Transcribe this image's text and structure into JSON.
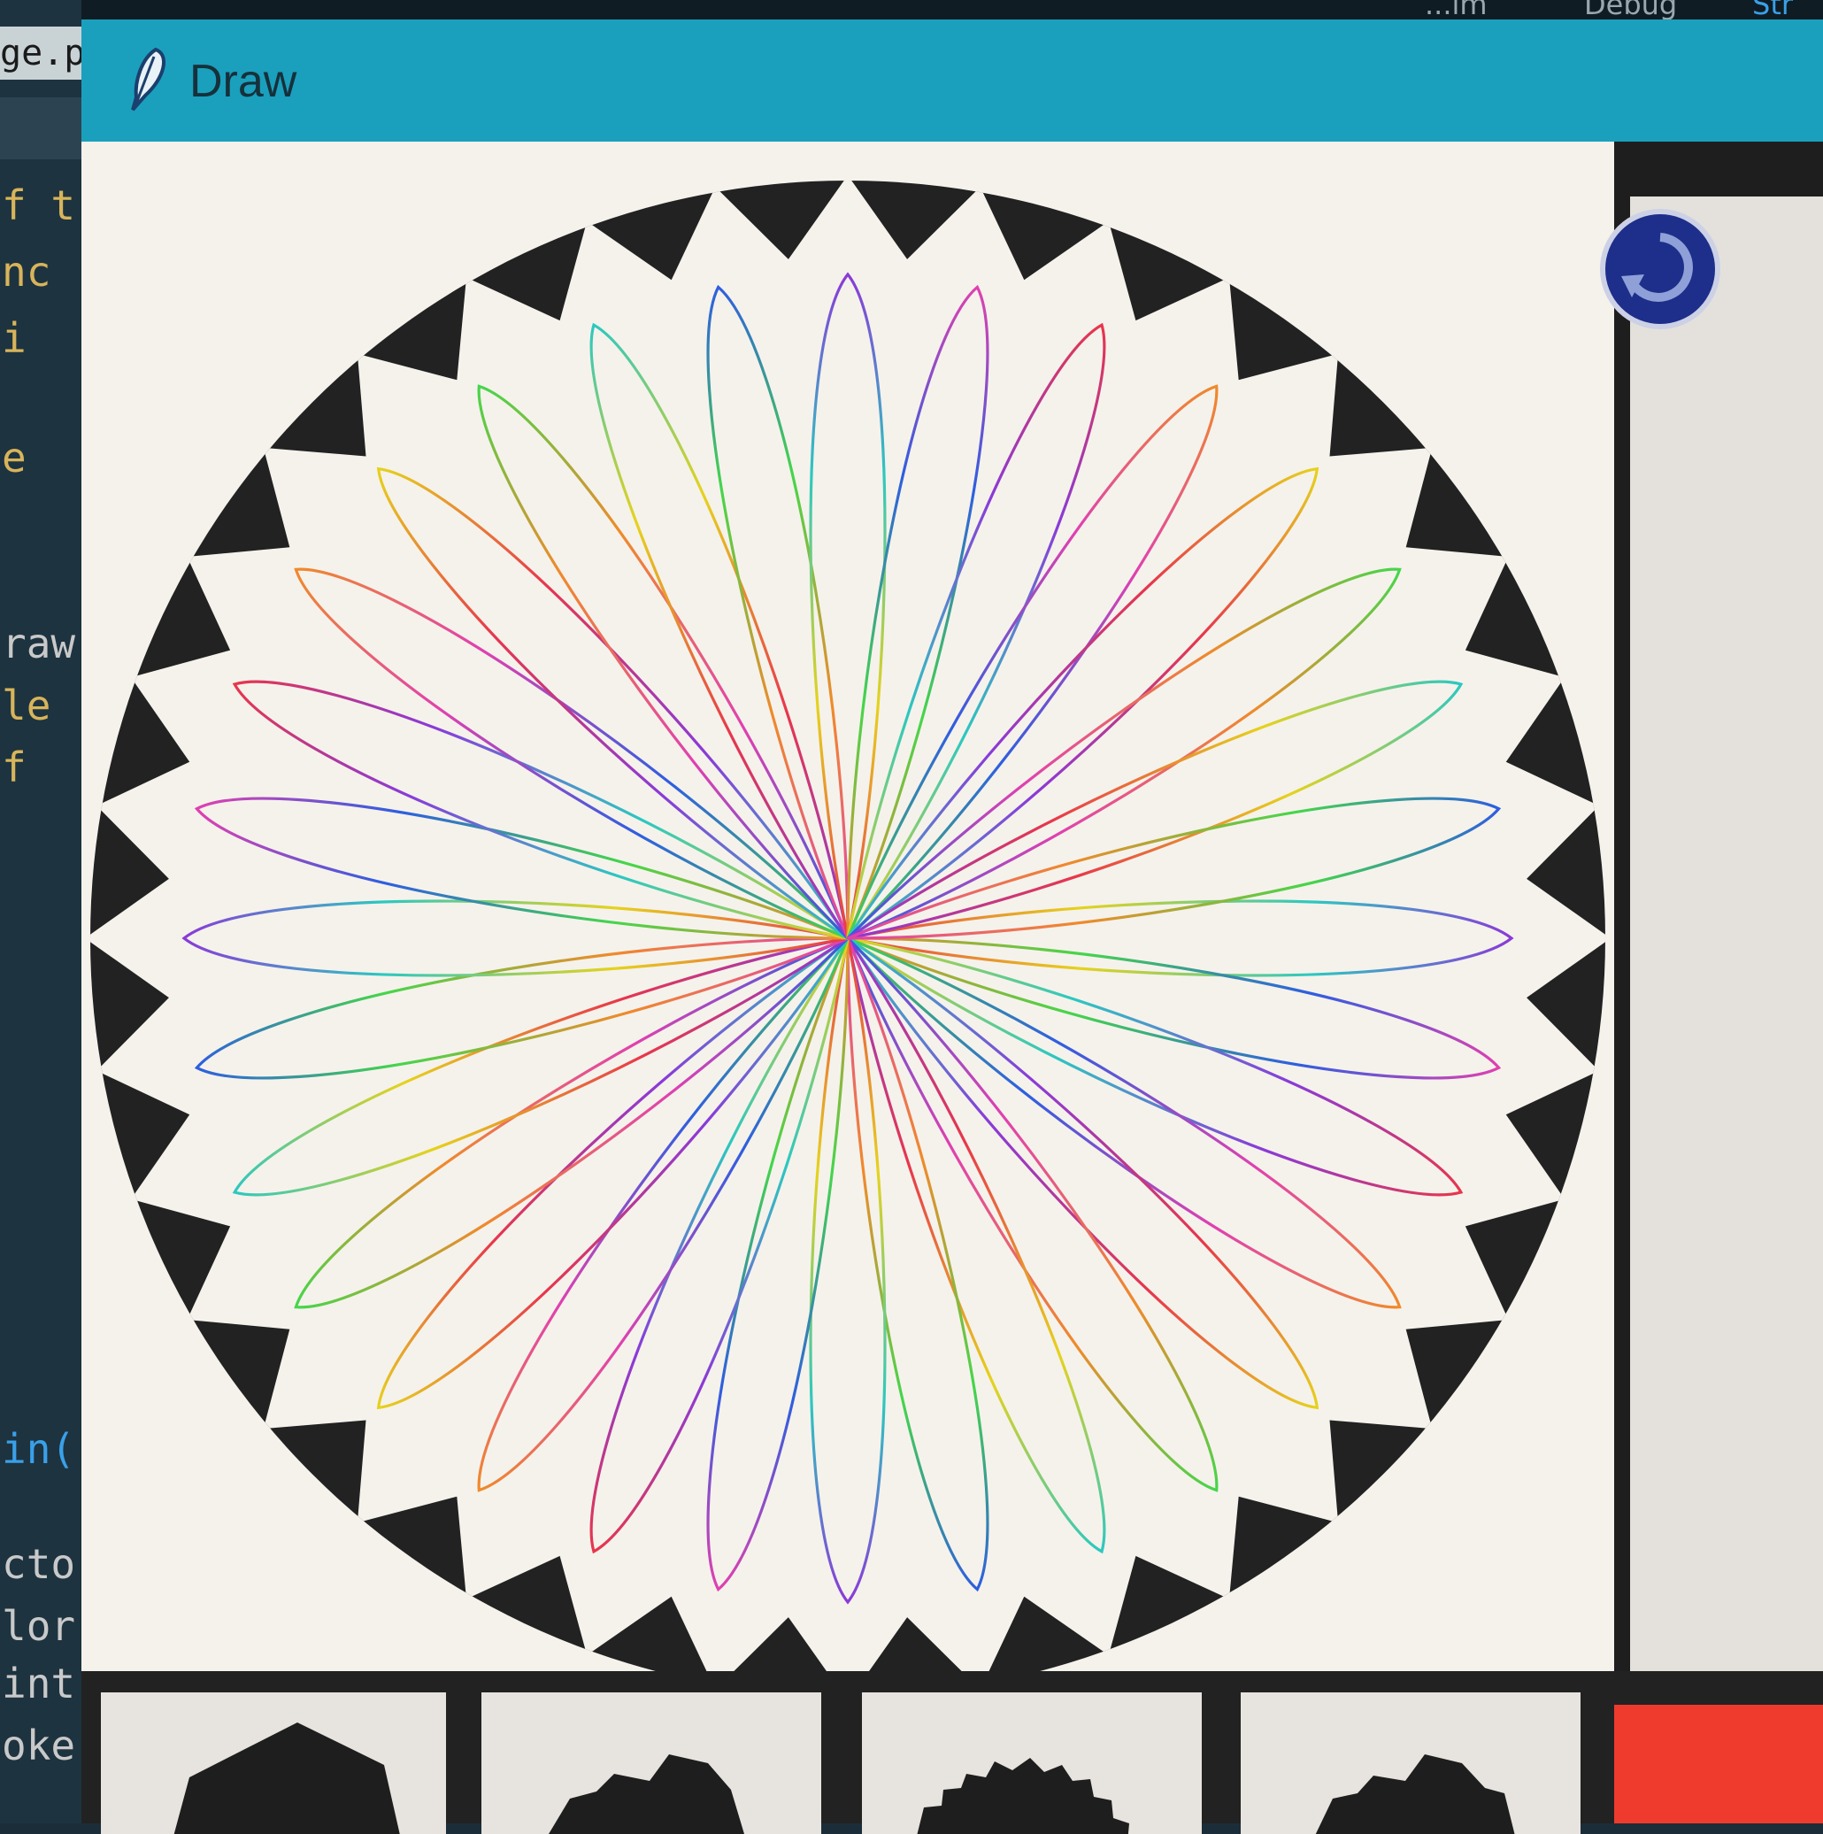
{
  "editor": {
    "file_tab": "ge.py",
    "code_lines": [
      {
        "text": "f t",
        "color": "#d8b45a"
      },
      {
        "text": " nc",
        "color": "#d8b45a"
      },
      {
        "text": "  i",
        "color": "#d8b45a"
      },
      {
        "text": "  e",
        "color": "#d8b45a"
      },
      {
        "text": "raw",
        "color": "#c9c9c9"
      },
      {
        "text": " le",
        "color": "#d8b45a"
      },
      {
        "text": "  f",
        "color": "#d8b45a"
      },
      {
        "text": "in(",
        "color": "#3aa0e8"
      },
      {
        "text": "cto",
        "color": "#c9c9c9"
      },
      {
        "text": "lor",
        "color": "#c9c9c9"
      },
      {
        "text": "int",
        "color": "#c9c9c9"
      },
      {
        "text": "oke",
        "color": "#c9c9c9"
      }
    ]
  },
  "menubar": {
    "items": [
      "...lm",
      "Debug",
      "Str"
    ]
  },
  "window": {
    "title": "Draw",
    "app_icon": "feather-icon"
  },
  "canvas": {
    "drawing": "spirograph",
    "petal_count": 32,
    "outer_border": "zigzag-star",
    "star_points": 36,
    "petal_colors": [
      "#e8364b",
      "#f08a2a",
      "#e6d21c",
      "#45d64a",
      "#2cc8c0",
      "#2e5ee0",
      "#8a3ad8",
      "#e040b0"
    ]
  },
  "side_panel": {
    "refresh_button_icon": "refresh-icon",
    "accent": "#1d2f8a"
  },
  "thumbnails": [
    {
      "shape": "hexagon-icon"
    },
    {
      "shape": "notched-shape-icon"
    },
    {
      "shape": "starburst-icon"
    },
    {
      "shape": "notched-shape-icon"
    }
  ],
  "current_color": "#ee3b2e"
}
